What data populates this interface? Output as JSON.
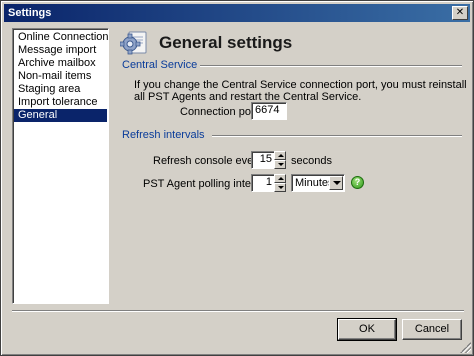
{
  "window": {
    "title": "Settings",
    "close_glyph": "✕"
  },
  "nav": {
    "items": [
      {
        "label": "Online Connection"
      },
      {
        "label": "Message import"
      },
      {
        "label": "Archive mailbox"
      },
      {
        "label": "Non-mail items"
      },
      {
        "label": "Staging area"
      },
      {
        "label": "Import tolerance"
      },
      {
        "label": "General"
      }
    ],
    "selected_index": 6
  },
  "header": {
    "title": "General settings",
    "icon": "settings-gear-icon"
  },
  "central_service": {
    "group_title": "Central Service",
    "info_line1": "If you change the Central Service connection port, you must reinstall",
    "info_line2": "all PST Agents and restart the Central Service.",
    "port_label": "Connection port:",
    "port_value": "6674"
  },
  "refresh": {
    "group_title": "Refresh intervals",
    "console_label": "Refresh console every:",
    "console_value": "15",
    "console_unit": "seconds",
    "agent_label": "PST Agent polling interval:",
    "agent_value": "1",
    "agent_unit_selected": "Minutes",
    "help_glyph": "?"
  },
  "buttons": {
    "ok": "OK",
    "cancel": "Cancel"
  },
  "colors": {
    "selection": "#0a246a",
    "group_title": "#0a3c9a",
    "face": "#d4d0c8"
  }
}
